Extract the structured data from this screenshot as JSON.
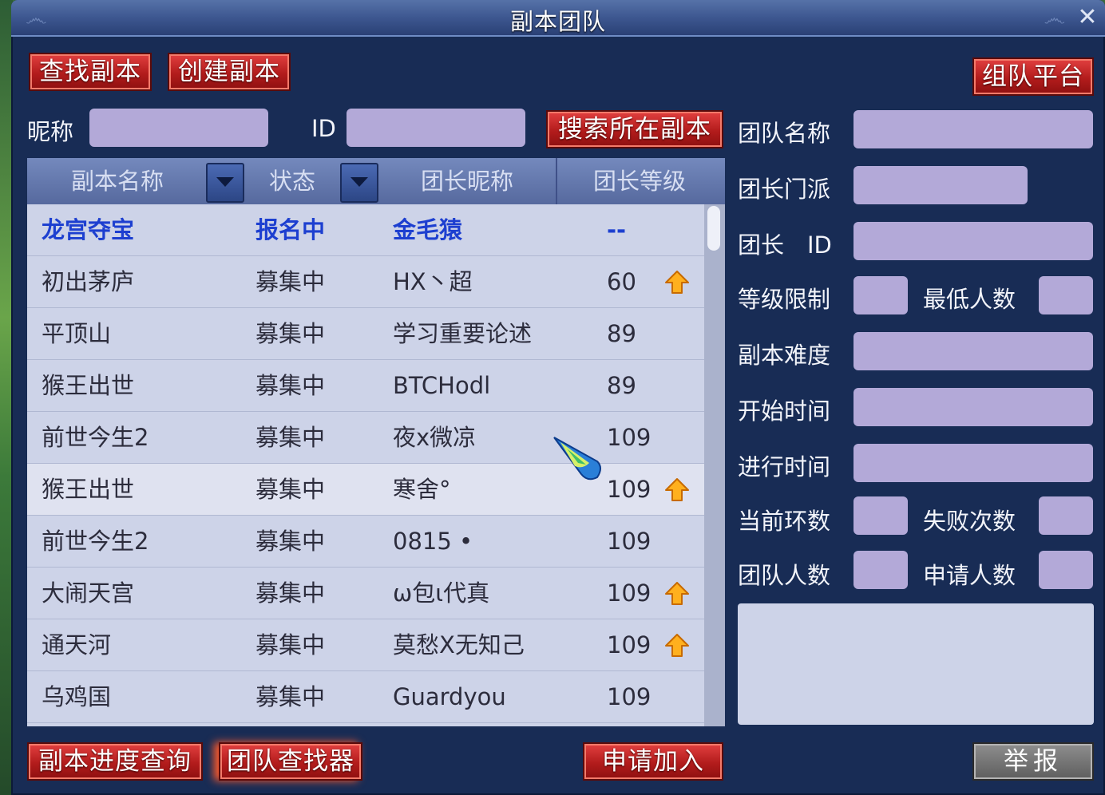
{
  "window": {
    "title": "副本团队",
    "close_icon": "close-icon"
  },
  "tabs": {
    "find": "查找副本",
    "create": "创建副本"
  },
  "team_platform": "组队平台",
  "search": {
    "nickname_label": "昵称",
    "id_label": "ID",
    "nickname_value": "",
    "id_value": "",
    "button": "搜索所在副本"
  },
  "table": {
    "headers": [
      "副本名称",
      "状态",
      "团长昵称",
      "团长等级"
    ],
    "rows": [
      {
        "name": "龙宫夺宝",
        "status": "报名中",
        "leader": "金毛猿",
        "level": "--",
        "arrow": false,
        "highlight": true
      },
      {
        "name": "初出茅庐",
        "status": "募集中",
        "leader": "HX丶超",
        "level": "60",
        "arrow": true
      },
      {
        "name": "平顶山",
        "status": "募集中",
        "leader": "学习重要论述",
        "level": "89",
        "arrow": false
      },
      {
        "name": "猴王出世",
        "status": "募集中",
        "leader": "BTCHodl",
        "level": "89",
        "arrow": false
      },
      {
        "name": "前世今生2",
        "status": "募集中",
        "leader": "夜x微凉",
        "level": "109",
        "arrow": false
      },
      {
        "name": "猴王出世",
        "status": "募集中",
        "leader": "寒舍°",
        "level": "109",
        "arrow": true,
        "selected": true
      },
      {
        "name": "前世今生2",
        "status": "募集中",
        "leader": "0815 •",
        "level": "109",
        "arrow": false
      },
      {
        "name": "大闹天宫",
        "status": "募集中",
        "leader": "ω包ι代真",
        "level": "109",
        "arrow": true
      },
      {
        "name": "通天河",
        "status": "募集中",
        "leader": "莫愁X无知己",
        "level": "109",
        "arrow": true
      },
      {
        "name": "乌鸡国",
        "status": "募集中",
        "leader": "Guardyou",
        "level": "109",
        "arrow": false
      }
    ]
  },
  "info": {
    "team_name": "团队名称",
    "leader_school": "团长门派",
    "leader_id": "团长　ID",
    "level_limit": "等级限制",
    "min_members": "最低人数",
    "difficulty": "副本难度",
    "start_time": "开始时间",
    "elapsed_time": "进行时间",
    "current_round": "当前环数",
    "fail_count": "失败次数",
    "team_size": "团队人数",
    "applicants": "申请人数"
  },
  "bottom": {
    "progress_query": "副本进度查询",
    "team_finder": "团队查找器",
    "apply_join": "申请加入",
    "report": "举报"
  },
  "colors": {
    "accent_red": "#c42424",
    "panel_blue": "#182c55",
    "field_lilac": "#b3a9d8",
    "highlight_text": "#1d3fd0"
  }
}
